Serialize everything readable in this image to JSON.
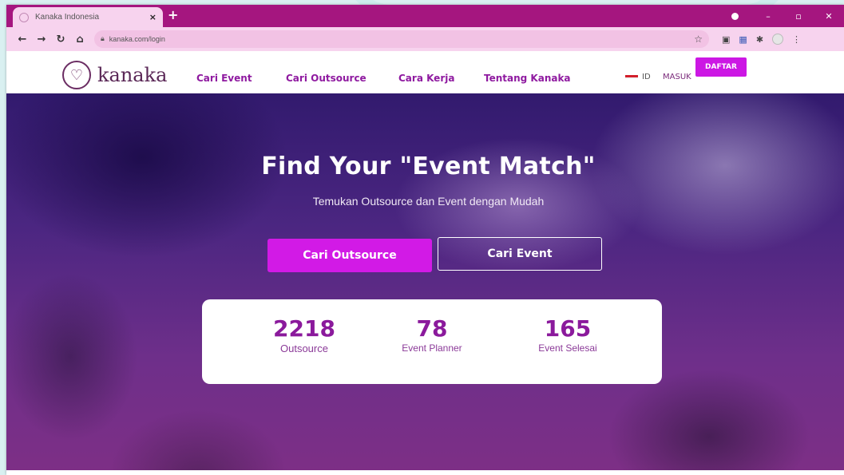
{
  "browser": {
    "tab_title": "Kanaka Indonesia",
    "tab_close": "×",
    "new_tab": "+",
    "url": "kanaka.com/login",
    "controls": {
      "minimize": "–",
      "restore": "▫",
      "close": "✕"
    }
  },
  "site": {
    "logo_text": "kanaka",
    "nav": [
      "Cari Event",
      "Cari Outsource",
      "Cara Kerja",
      "Tentang Kanaka"
    ],
    "lang": "ID",
    "login": "MASUK",
    "register": "DAFTAR"
  },
  "hero": {
    "title": "Find Your \"Event Match\"",
    "subtitle": "Temukan Outsource dan Event dengan Mudah",
    "primary_button": "Cari Outsource",
    "secondary_button": "Cari Event"
  },
  "stats": [
    {
      "value": "2218",
      "label": "Outsource"
    },
    {
      "value": "78",
      "label": "Event Planner"
    },
    {
      "value": "165",
      "label": "Event Selesai"
    }
  ],
  "colors": {
    "browser_frame": "#a5167f",
    "accent": "#cc17e4",
    "nav_text": "#8f1aa0"
  }
}
